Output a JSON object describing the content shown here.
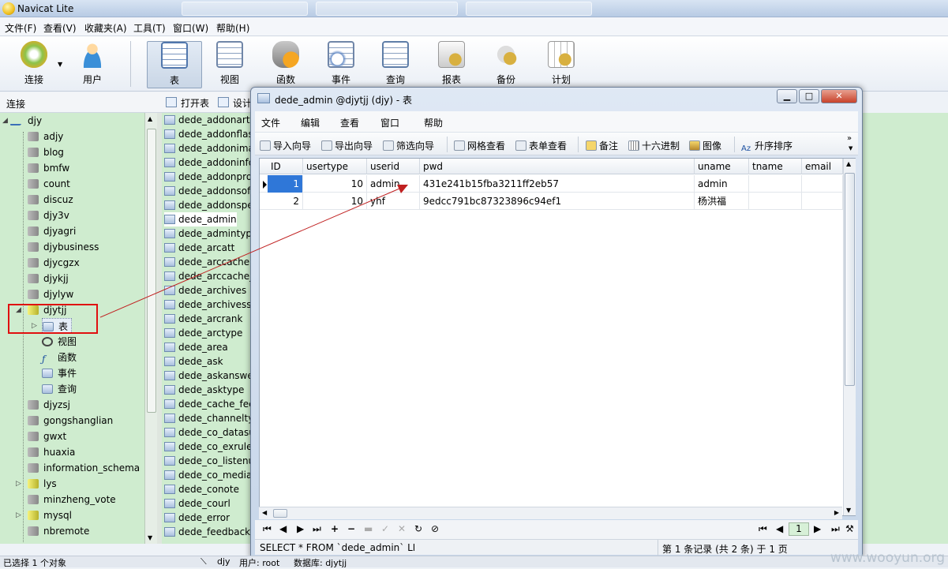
{
  "app": {
    "title": "Navicat Lite"
  },
  "menubar": [
    "文件(F)",
    "查看(V)",
    "收藏夹(A)",
    "工具(T)",
    "窗口(W)",
    "帮助(H)"
  ],
  "toolbar": [
    {
      "label": "连接",
      "icon": "connect-icon"
    },
    {
      "label": "用户",
      "icon": "user-icon"
    },
    {
      "label": "表",
      "icon": "table-icon"
    },
    {
      "label": "视图",
      "icon": "view-icon"
    },
    {
      "label": "函数",
      "icon": "function-icon"
    },
    {
      "label": "事件",
      "icon": "event-icon"
    },
    {
      "label": "查询",
      "icon": "query-icon"
    },
    {
      "label": "报表",
      "icon": "report-icon"
    },
    {
      "label": "备份",
      "icon": "backup-icon"
    },
    {
      "label": "计划",
      "icon": "schedule-icon"
    }
  ],
  "left_panel": {
    "header": "连接"
  },
  "tree": {
    "root": "djy",
    "databases": [
      "adjy",
      "blog",
      "bmfw",
      "count",
      "discuz",
      "djy3v",
      "djyagri",
      "djybusiness",
      "djycgzx",
      "djykjj",
      "djylyw"
    ],
    "open_db": "djytjj",
    "open_children": [
      "表",
      "视图",
      "函数",
      "事件",
      "查询"
    ],
    "more_databases": [
      "djyzsj",
      "gongshanglian",
      "gwxt",
      "huaxia",
      "information_schema",
      "lys",
      "minzheng_vote",
      "mysql",
      "nbremote"
    ]
  },
  "mid_panel": {
    "header_open": "打开表",
    "header_design": "设计",
    "tables": [
      "dede_addonarti",
      "dede_addonflas",
      "dede_addonima",
      "dede_addoninfo",
      "dede_addonpro",
      "dede_addonsof",
      "dede_addonspe",
      "dede_admin",
      "dede_admintyp",
      "dede_arcatt",
      "dede_arccache",
      "dede_arccache_",
      "dede_archives",
      "dede_archivessp",
      "dede_arcrank",
      "dede_arctype",
      "dede_area",
      "dede_ask",
      "dede_askanswe",
      "dede_asktype",
      "dede_cache_fee",
      "dede_channelty",
      "dede_co_datasu",
      "dede_co_exrule",
      "dede_co_listenu",
      "dede_co_media",
      "dede_conote",
      "dede_courl",
      "dede_error",
      "dede_feedback"
    ],
    "selected": "dede_admin"
  },
  "dialog": {
    "title": "dede_admin @djytjj (djy) - 表",
    "menu": [
      "文件",
      "编辑",
      "查看",
      "窗口",
      "帮助"
    ],
    "toolbar": [
      "导入向导",
      "导出向导",
      "筛选向导",
      "网格查看",
      "表单查看",
      "备注",
      "十六进制",
      "图像",
      "升序排序"
    ],
    "columns": [
      "ID",
      "usertype",
      "userid",
      "pwd",
      "uname",
      "tname",
      "email"
    ],
    "rows": [
      [
        "1",
        "10",
        "admin",
        "431e241b15fba3211ff2eb57",
        "admin",
        "",
        ""
      ],
      [
        "2",
        "10",
        "yhf",
        "9edcc791bc87323896c94ef1",
        "杨洪福",
        "",
        ""
      ]
    ],
    "page": "1",
    "sql": "SELECT * FROM `dede_admin` LIN",
    "record_info": "第 1 条记录 (共 2 条) 于 1 页"
  },
  "status": {
    "left": "已选择 1 个对象",
    "conn": "djy",
    "user": "用户: root",
    "db": "数据库: djytjj"
  },
  "watermark": "www.wooyun.org",
  "colors": {
    "highlight_box": "#e01010",
    "arrow": "#c02020",
    "tree_bg": "#cfeccf",
    "selected_cell": "#2f77d8"
  }
}
